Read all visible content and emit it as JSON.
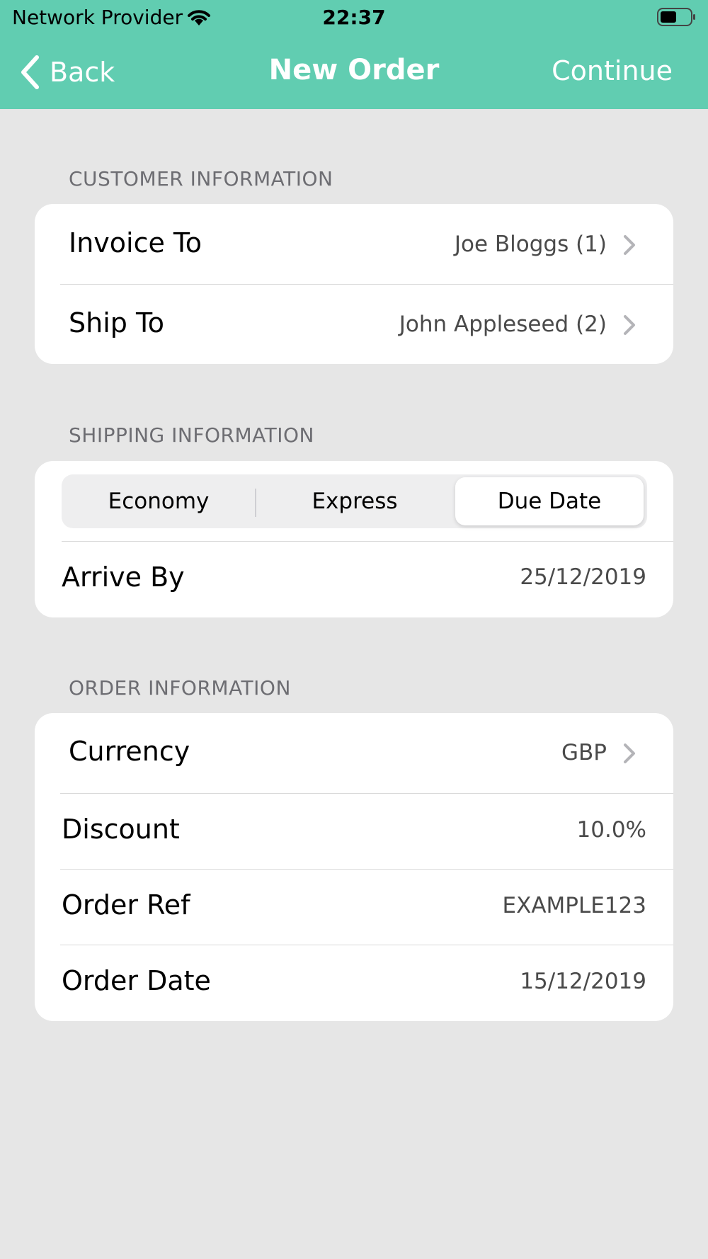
{
  "status_bar": {
    "carrier": "Network Provider",
    "time": "22:37"
  },
  "nav": {
    "back_label": "Back",
    "title": "New Order",
    "continue_label": "Continue"
  },
  "customer": {
    "header": "CUSTOMER INFORMATION",
    "invoice_to": {
      "label": "Invoice To",
      "value": "Joe Bloggs (1)"
    },
    "ship_to": {
      "label": "Ship To",
      "value": "John Appleseed (2)"
    }
  },
  "shipping": {
    "header": "SHIPPING INFORMATION",
    "segments": [
      "Economy",
      "Express",
      "Due Date"
    ],
    "selected_segment": "Due Date",
    "arrive_by": {
      "label": "Arrive By",
      "value": "25/12/2019"
    }
  },
  "order": {
    "header": "ORDER INFORMATION",
    "currency": {
      "label": "Currency",
      "value": "GBP"
    },
    "discount": {
      "label": "Discount",
      "value": "10.0%"
    },
    "order_ref": {
      "label": "Order Ref",
      "value": "EXAMPLE123"
    },
    "order_date": {
      "label": "Order Date",
      "value": "15/12/2019"
    }
  },
  "colors": {
    "accent": "#61cdb1",
    "background": "#e6e6e6",
    "secondary_text": "#6d6d72"
  },
  "icons": [
    "wifi-icon",
    "battery-icon",
    "chevron-left-icon",
    "chevron-right-icon"
  ]
}
